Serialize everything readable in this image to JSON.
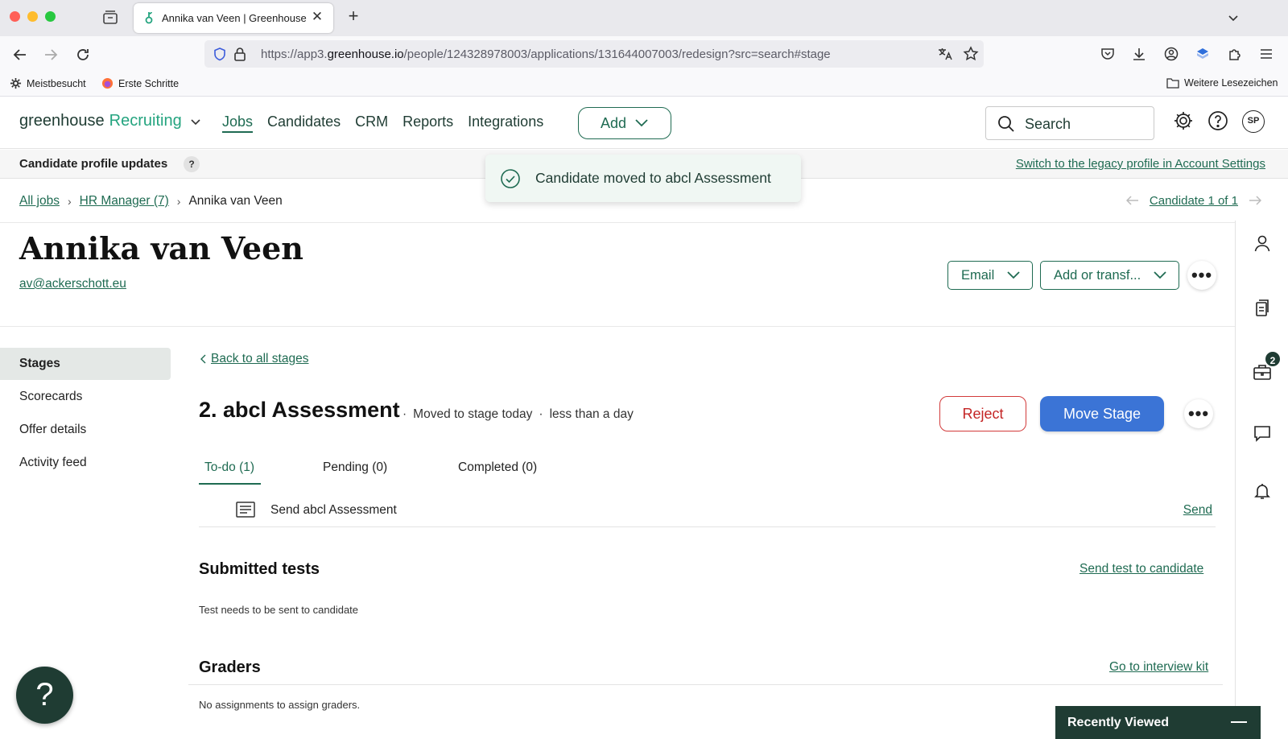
{
  "browser": {
    "tab_title": "Annika van Veen | Greenhouse",
    "url_prefix": "https://app3.",
    "url_domain": "greenhouse.io",
    "url_path": "/people/124328978003/applications/131644007003/redesign?src=search#stage",
    "bookmarks": [
      "Meistbesucht",
      "Erste Schritte"
    ],
    "other_bookmarks": "Weitere Lesezeichen"
  },
  "app": {
    "brand_word": "greenhouse",
    "brand_product": "Recruiting",
    "nav": [
      "Jobs",
      "Candidates",
      "CRM",
      "Reports",
      "Integrations"
    ],
    "add_label": "Add",
    "search_placeholder": "Search",
    "avatar_initials": "SP"
  },
  "banner": {
    "title": "Candidate profile updates",
    "help": "?",
    "link": "Switch to the legacy profile in Account Settings"
  },
  "toast": {
    "message": "Candidate moved to abcl Assessment"
  },
  "breadcrumb": {
    "all_jobs": "All jobs",
    "job": "HR Manager (7)",
    "current": "Annika van Veen",
    "candidate_pos": "Candidate 1 of 1"
  },
  "candidate": {
    "name": "Annika van Veen",
    "email": "av@ackerschott.eu",
    "email_btn": "Email",
    "transfer_btn": "Add or transf..."
  },
  "leftnav": [
    "Stages",
    "Scorecards",
    "Offer details",
    "Activity feed"
  ],
  "stage": {
    "back": "Back to all stages",
    "title": "2. abcl Assessment",
    "moved": "Moved to stage today",
    "duration": "less than a day",
    "reject": "Reject",
    "move": "Move Stage",
    "tabs": [
      "To-do (1)",
      "Pending (0)",
      "Completed (0)"
    ],
    "todo_item": "Send abcl Assessment",
    "todo_action": "Send"
  },
  "submitted_tests": {
    "title": "Submitted tests",
    "link": "Send test to candidate",
    "note": "Test needs to be sent to candidate"
  },
  "graders": {
    "title": "Graders",
    "link": "Go to interview kit",
    "note": "No assignments to assign graders."
  },
  "rail": {
    "badge_count": "2"
  },
  "help_fab": "?",
  "recently_viewed": "Recently Viewed",
  "colors": {
    "brand_green": "#1f6b52",
    "dark_green": "#1f3c33",
    "primary_blue": "#3b74d6",
    "reject_red": "#c42525"
  }
}
